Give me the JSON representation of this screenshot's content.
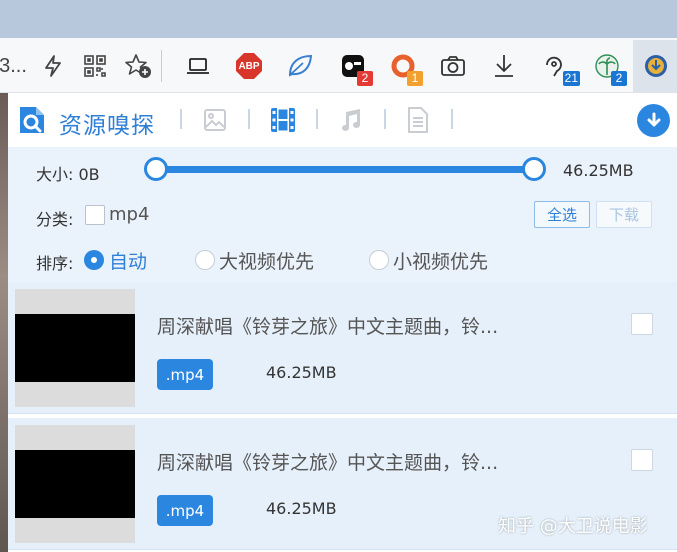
{
  "browser": {
    "truncated_text": "3...",
    "badges": {
      "abp_label": "ABP",
      "ext_a": "2",
      "ext_b": "1",
      "ext_c": "21",
      "ext_d": "2"
    }
  },
  "popup": {
    "title": "资源嗅探",
    "tabs": [
      "image-icon",
      "video-icon",
      "music-icon",
      "document-icon"
    ],
    "filters": {
      "size_min": "大小: 0B",
      "size_max": "46.25MB",
      "slider_range": [
        0,
        1
      ],
      "category_label": "分类:",
      "category_option": "mp4",
      "select_all": "全选",
      "download": "下载"
    },
    "sort": {
      "label": "排序:",
      "options": [
        "自动",
        "大视频优先",
        "小视频优先"
      ],
      "selected": "自动"
    },
    "items": [
      {
        "title": "周深献唱《铃芽之旅》中文主题曲，铃...",
        "ext": ".mp4",
        "size": "46.25MB"
      },
      {
        "title": "周深献唱《铃芽之旅》中文主题曲，铃...",
        "ext": ".mp4",
        "size": "46.25MB"
      }
    ]
  },
  "watermark": "知乎 @大卫说电影",
  "colors": {
    "accent": "#2b86e0",
    "filter_bg": "#eaf2fb",
    "item_bg": "#e6f0fa",
    "badge_red": "#e53935",
    "badge_orange": "#f2a12f",
    "badge_blue": "#1976d2"
  }
}
